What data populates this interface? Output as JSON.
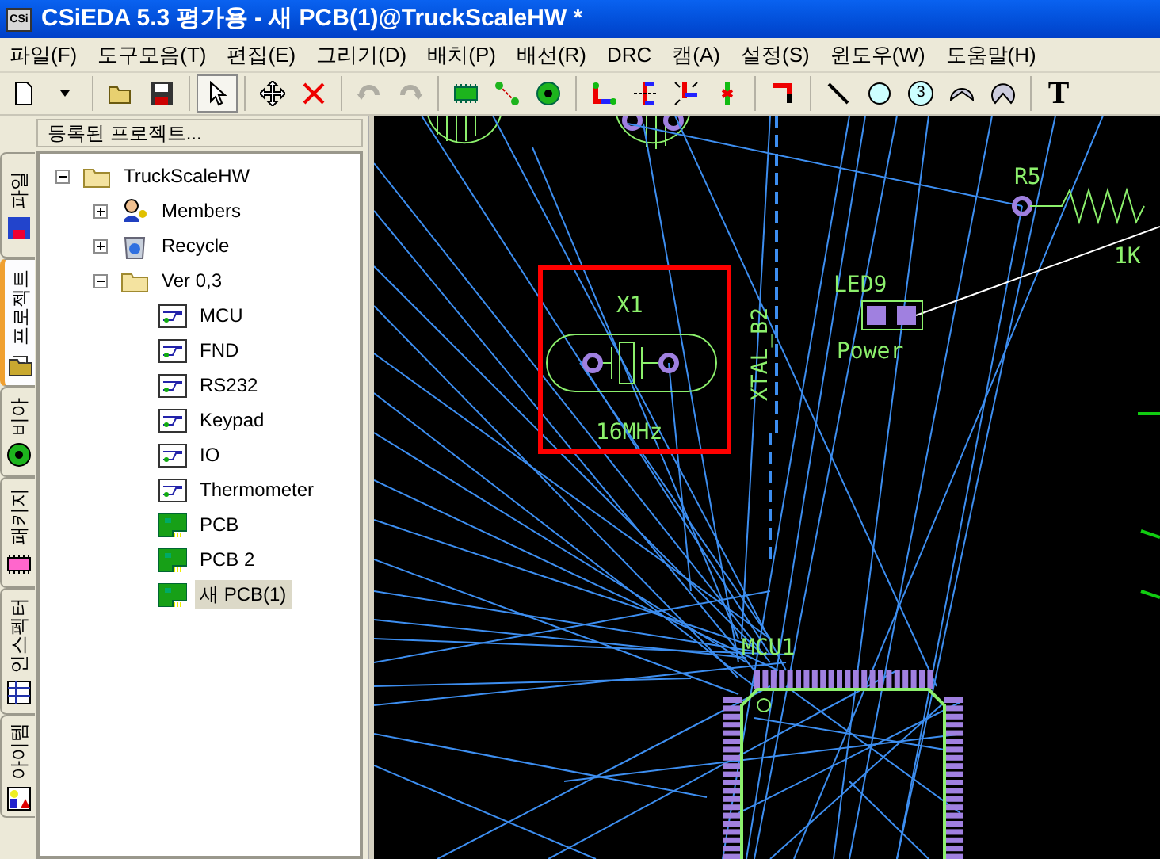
{
  "window": {
    "app_icon": "CSi",
    "title": "CSiEDA 5.3 평가용 - 새 PCB(1)@TruckScaleHW *"
  },
  "menu": [
    {
      "label": "파일(F)"
    },
    {
      "label": "도구모음(T)"
    },
    {
      "label": "편집(E)"
    },
    {
      "label": "그리기(D)"
    },
    {
      "label": "배치(P)"
    },
    {
      "label": "배선(R)"
    },
    {
      "label": "DRC"
    },
    {
      "label": "캠(A)"
    },
    {
      "label": "설정(S)"
    },
    {
      "label": "윈도우(W)"
    },
    {
      "label": "도움말(H)"
    }
  ],
  "toolbar": {
    "pointer_pressed": true,
    "undo_disabled": true,
    "redo_disabled": true,
    "numbered_circle": "3",
    "text_tool": "T"
  },
  "side_tabs": [
    {
      "label": "파일",
      "selected": false
    },
    {
      "label": "프로젝트",
      "selected": true
    },
    {
      "label": "비아",
      "selected": false
    },
    {
      "label": "패키지",
      "selected": false
    },
    {
      "label": "인스펙터",
      "selected": false
    },
    {
      "label": "아이템",
      "selected": false
    }
  ],
  "panel": {
    "title": "등록된 프로젝트...",
    "tree": [
      {
        "label": "TruckScaleHW",
        "kind": "folder",
        "expanded": true,
        "selected": false,
        "children": [
          {
            "label": "Members",
            "kind": "members",
            "expanded": false,
            "selected": false
          },
          {
            "label": "Recycle",
            "kind": "recycle",
            "expanded": false,
            "selected": false
          },
          {
            "label": "Ver 0,3",
            "kind": "folder",
            "expanded": true,
            "selected": false,
            "children": [
              {
                "label": "MCU",
                "kind": "schematic",
                "selected": false
              },
              {
                "label": "FND",
                "kind": "schematic",
                "selected": false
              },
              {
                "label": "RS232",
                "kind": "schematic",
                "selected": false
              },
              {
                "label": "Keypad",
                "kind": "schematic",
                "selected": false
              },
              {
                "label": "IO",
                "kind": "schematic",
                "selected": false
              },
              {
                "label": "Thermometer",
                "kind": "schematic",
                "selected": false
              },
              {
                "label": "PCB",
                "kind": "pcb",
                "selected": false
              },
              {
                "label": "PCB 2",
                "kind": "pcb",
                "selected": false
              },
              {
                "label": "새 PCB(1)",
                "kind": "pcb",
                "selected": true
              }
            ]
          }
        ]
      }
    ]
  },
  "canvas": {
    "net_label": "XTAL_B2",
    "parts": [
      {
        "kind": "crystal",
        "ref": "X1",
        "value": "16MHz",
        "selected": true
      },
      {
        "kind": "led",
        "ref": "LED9",
        "value": "Power",
        "selected": false
      },
      {
        "kind": "resistor",
        "ref": "R5",
        "value": "1K",
        "selected": false
      },
      {
        "kind": "chip",
        "ref": "MCU1",
        "selected": false
      }
    ]
  }
}
